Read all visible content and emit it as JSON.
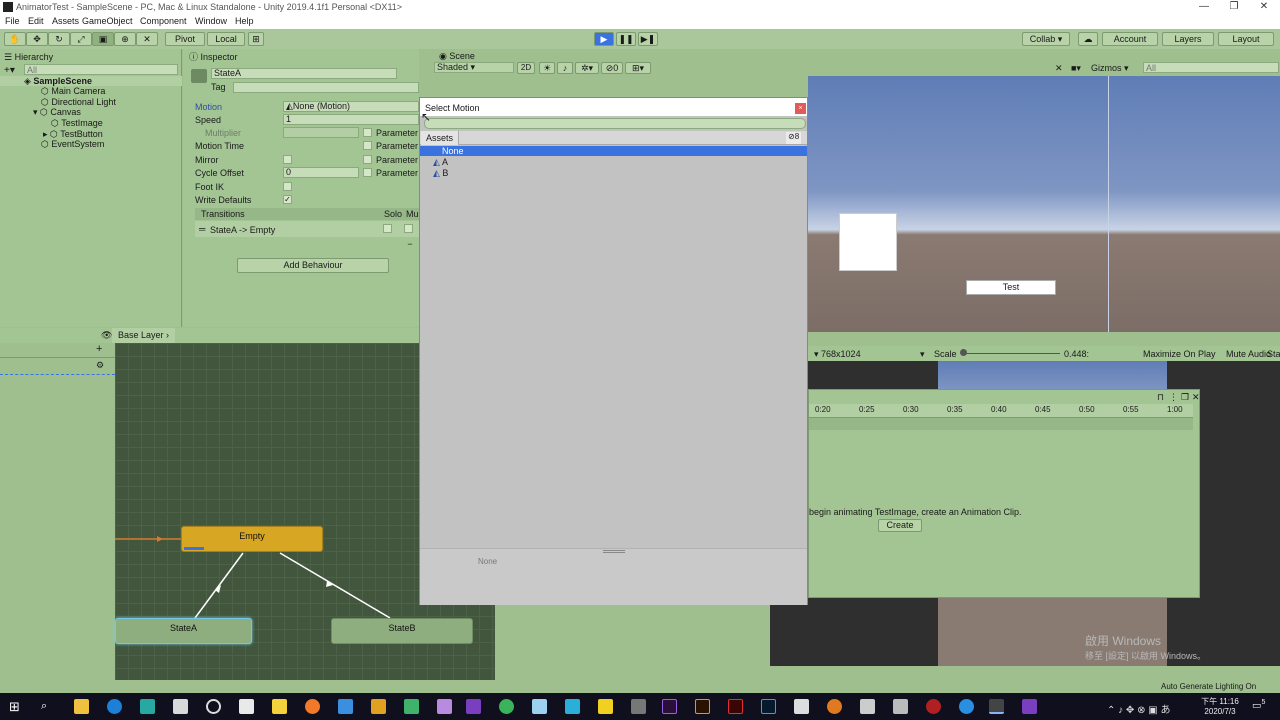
{
  "window": {
    "title": "AnimatorTest - SampleScene - PC, Mac & Linux Standalone - Unity 2019.4.1f1 Personal <DX11>",
    "minimize": "—",
    "maximize": "❐",
    "close": "✕"
  },
  "menu": [
    "File",
    "Edit",
    "Assets",
    "GameObject",
    "Component",
    "Window",
    "Help"
  ],
  "toolbar": {
    "pivot": "Pivot",
    "local": "Local",
    "collab": "Collab ▾",
    "account": "Account",
    "layers": "Layers",
    "layout": "Layout"
  },
  "hierarchy": {
    "tab": "Hierarchy",
    "search_placeholder": "All",
    "items": [
      {
        "label": "SampleScene",
        "indent": 0
      },
      {
        "label": "Main Camera",
        "indent": 2
      },
      {
        "label": "Directional Light",
        "indent": 2
      },
      {
        "label": "Canvas",
        "indent": 1
      },
      {
        "label": "TestImage",
        "indent": 3
      },
      {
        "label": "TestButton",
        "indent": 2
      },
      {
        "label": "EventSystem",
        "indent": 2
      }
    ]
  },
  "inspector": {
    "tab": "Inspector",
    "name": "StateA",
    "tag_label": "Tag",
    "motion_label": "Motion",
    "motion_value": "None (Motion)",
    "speed_label": "Speed",
    "speed_value": "1",
    "multiplier_label": "Multiplier",
    "motion_time_label": "Motion Time",
    "mirror_label": "Mirror",
    "cycle_offset_label": "Cycle Offset",
    "cycle_offset_value": "0",
    "foot_ik_label": "Foot IK",
    "write_defaults_label": "Write Defaults",
    "parameter": "Parameter",
    "transitions_label": "Transitions",
    "solo_label": "Solo",
    "mute_label": "Mu",
    "transition_item": "StateA -> Empty",
    "add_behaviour": "Add Behaviour",
    "write_defaults_check": "✓",
    "minus": "−"
  },
  "scene": {
    "tab": "Scene",
    "shaded": "Shaded",
    "mode_2d": "2D",
    "gizmos": "Gizmos",
    "search_placeholder": "All",
    "visibility_count": "0",
    "test_button": "Test"
  },
  "game_bar": {
    "resolution": "768x1024",
    "scale_label": "Scale",
    "scale_value": "0.448:",
    "maximize": "Maximize On Play",
    "mute": "Mute Audio",
    "stats": "Sta"
  },
  "animator": {
    "layer": "Base Layer",
    "nodes": {
      "empty": "Empty",
      "stateA": "StateA",
      "stateB": "StateB"
    }
  },
  "animation_window": {
    "ticks": [
      "0:20",
      "0:25",
      "0:30",
      "0:35",
      "0:40",
      "0:45",
      "0:50",
      "0:55",
      "1:00"
    ],
    "message": "begin animating TestImage, create an Animation Clip.",
    "create": "Create"
  },
  "dialog": {
    "title": "Select Motion",
    "tab_assets": "Assets",
    "visibility_count": "8",
    "items": [
      "None",
      "A",
      "B"
    ],
    "selected": "None",
    "footer": "None"
  },
  "status": {
    "auto_generate": "Auto Generate Lighting On"
  },
  "watermark": {
    "line1": "啟用 Windows",
    "line2": "移至 [設定] 以啟用 Windows。"
  },
  "taskbar": {
    "time": "下午 11:16",
    "date": "2020/7/3",
    "notifications": "5"
  },
  "colors": {
    "selected": "#3a72e0",
    "empty_node": "#d7a623",
    "state_node": "#8fae80",
    "toolbar_play_active": "#3a72e0"
  }
}
